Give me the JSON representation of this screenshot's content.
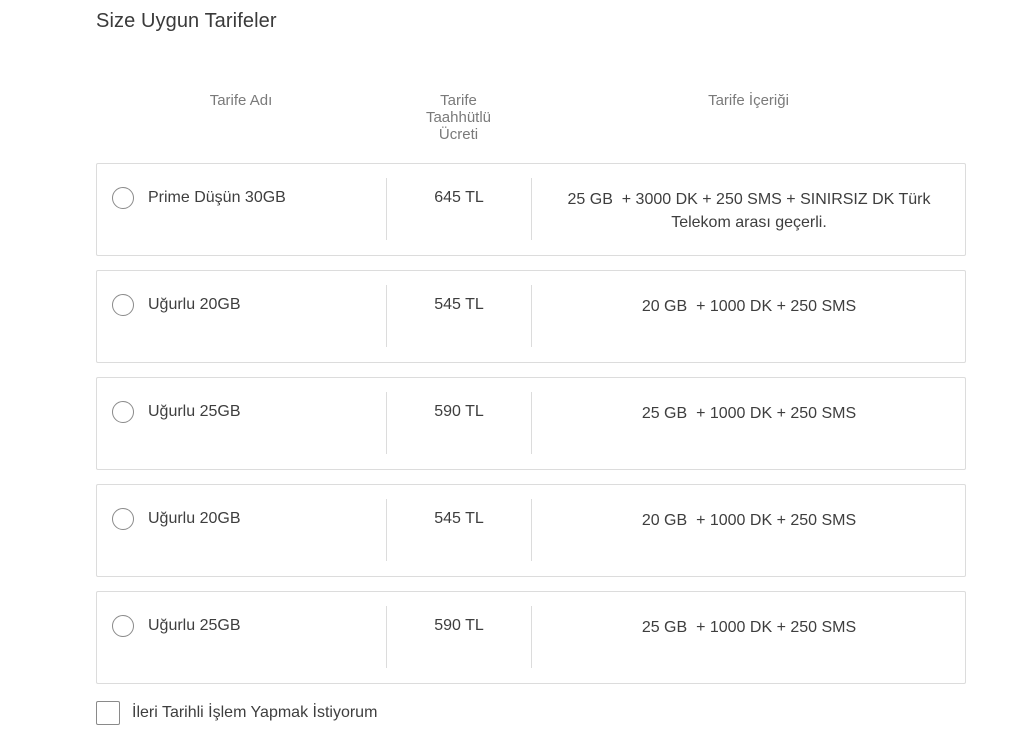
{
  "section": {
    "title": "Size Uygun Tarifeler"
  },
  "columns": {
    "name": "Tarife Adı",
    "price_line1": "Tarife",
    "price_line2": "Taahhütlü",
    "price_line3": "Ücreti",
    "content": "Tarife İçeriği"
  },
  "plans": [
    {
      "name": "Prime Düşün 30GB",
      "price": "645 TL",
      "content": "25 GB  + 3000 DK + 250 SMS + SINIRSIZ DK Türk Telekom arası geçerli."
    },
    {
      "name": "Uğurlu 20GB",
      "price": "545 TL",
      "content": "20 GB  + 1000 DK + 250 SMS"
    },
    {
      "name": "Uğurlu 25GB",
      "price": "590 TL",
      "content": "25 GB  + 1000 DK + 250 SMS"
    },
    {
      "name": "Uğurlu 20GB",
      "price": "545 TL",
      "content": "20 GB  + 1000 DK + 250 SMS"
    },
    {
      "name": "Uğurlu 25GB",
      "price": "590 TL",
      "content": "25 GB  + 1000 DK + 250 SMS"
    }
  ],
  "future_option": {
    "label": "İleri Tarihli İşlem Yapmak İstiyorum"
  }
}
